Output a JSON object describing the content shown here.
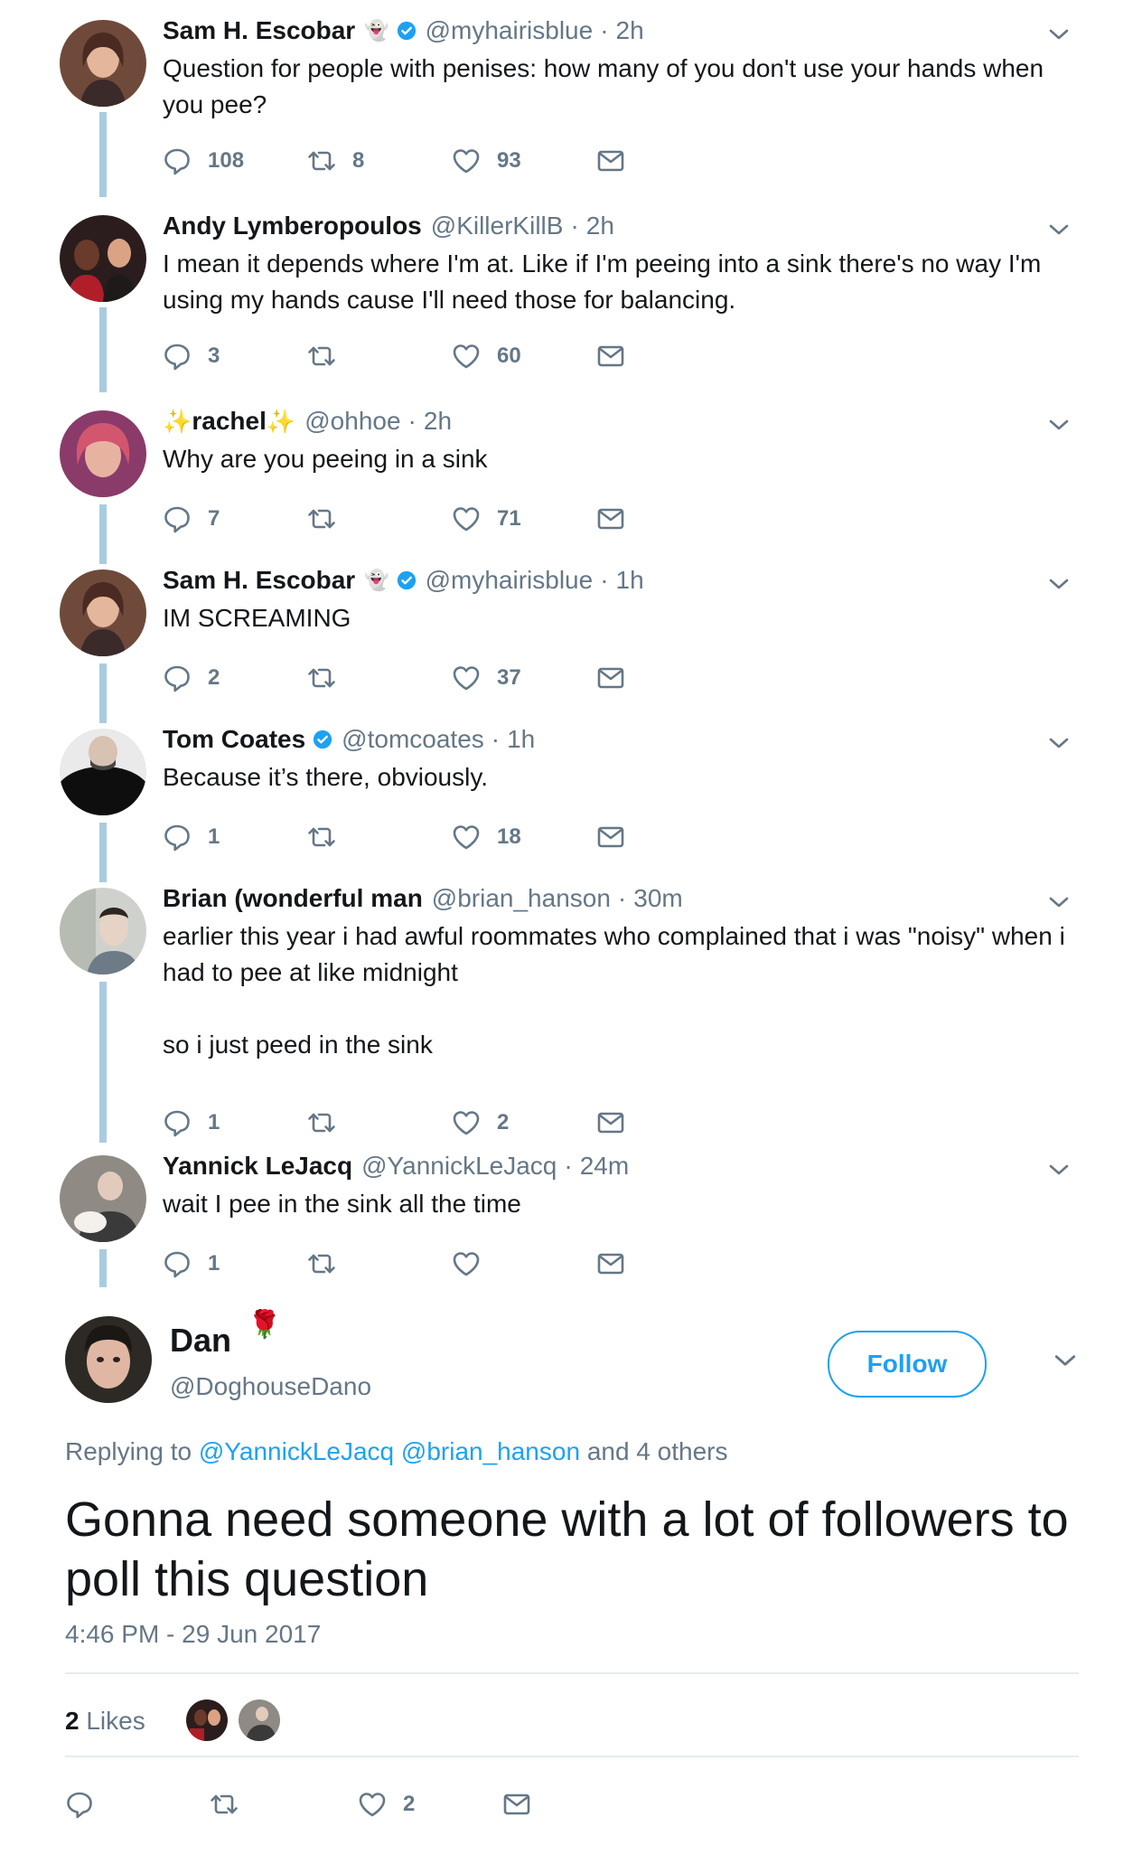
{
  "colors": {
    "link": "#1da1f2",
    "muted": "#657786",
    "text": "#14171a",
    "thread_line": "#a9cbe0",
    "divider": "#e6ecf0"
  },
  "tweets": [
    {
      "name": "Sam H. Escobar",
      "badge": "ghost-emoji",
      "verified": true,
      "handle": "@myhairisblue",
      "time": "2h",
      "text": "Question for people with penises: how many of you don't use your hands when you pee?",
      "replies": "108",
      "retweets": "8",
      "likes": "93"
    },
    {
      "name": "Andy Lymberopoulos",
      "verified": false,
      "handle": "@KillerKillB",
      "time": "2h",
      "text": "I mean it depends where I'm at. Like if I'm peeing into a sink there's no way I'm using my hands cause I'll need those for balancing.",
      "replies": "3",
      "retweets": "",
      "likes": "60"
    },
    {
      "name": "rachel",
      "name_decor": "✨",
      "verified": false,
      "handle": "@ohhoe",
      "time": "2h",
      "text": "Why are you peeing in a sink",
      "replies": "7",
      "retweets": "",
      "likes": "71"
    },
    {
      "name": "Sam H. Escobar",
      "badge": "ghost-emoji",
      "verified": true,
      "handle": "@myhairisblue",
      "time": "1h",
      "text": "IM SCREAMING",
      "replies": "2",
      "retweets": "",
      "likes": "37"
    },
    {
      "name": "Tom Coates",
      "verified": true,
      "handle": "@tomcoates",
      "time": "1h",
      "text": "Because it’s there, obviously.",
      "replies": "1",
      "retweets": "",
      "likes": "18"
    },
    {
      "name": "Brian (wonderful man",
      "verified": false,
      "handle": "@brian_hanson",
      "time": "30m",
      "text_lines": [
        "earlier this year i had awful roommates who complained that i was \"noisy\" when i had to pee at like midnight",
        "so i just peed in the sink"
      ],
      "replies": "1",
      "retweets": "",
      "likes": "2"
    },
    {
      "name": "Yannick LeJacq",
      "verified": false,
      "handle": "@YannickLeJacq",
      "time": "24m",
      "text": "wait I pee in the sink all the time",
      "replies": "1",
      "retweets": "",
      "likes": ""
    }
  ],
  "main": {
    "name": "Dan",
    "name_emoji": "🌹",
    "handle": "@DoghouseDano",
    "follow_label": "Follow",
    "replying_prefix": "Replying to",
    "replying_links": [
      "@YannickLeJacq",
      "@brian_hanson"
    ],
    "replying_suffix": "and 4 others",
    "text": "Gonna need someone with a lot of followers to poll this question",
    "timestamp": "4:46 PM - 29 Jun 2017",
    "likes_count": "2",
    "likes_label": "Likes",
    "action_likes": "2"
  },
  "sep": "·",
  "icons": [
    "reply-icon",
    "retweet-icon",
    "like-icon",
    "dm-icon",
    "chevron-down-icon",
    "verified-icon"
  ]
}
